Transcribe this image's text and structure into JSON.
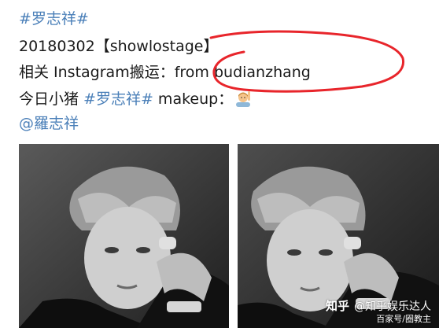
{
  "post": {
    "hashtag_title": "#罗志祥#",
    "line2_date": "20180302",
    "line2_source": "【showlostage】",
    "line3_prefix": "相关 Instagram搬运：from ",
    "line3_handle": "budianzhang",
    "line4_prefix": "今日小猪 ",
    "line4_hashtag": "#罗志祥#",
    "line4_suffix": " makeup：",
    "line4_emoji": "person-raising-hand-emoji",
    "mention": "@羅志祥"
  },
  "annotation": {
    "color": "#e8252b",
    "shape": "hand-drawn-circle"
  },
  "photos": [
    {
      "name": "photo-left",
      "style": "black-and-white portrait"
    },
    {
      "name": "photo-right",
      "style": "black-and-white portrait"
    }
  ],
  "watermark": {
    "logo": "知乎",
    "author": "@知乎娱乐达人",
    "sub": "百家号/圈教主"
  },
  "colors": {
    "link": "#4a7fb8",
    "text": "#1a1a1a",
    "annotation": "#e8252b"
  }
}
